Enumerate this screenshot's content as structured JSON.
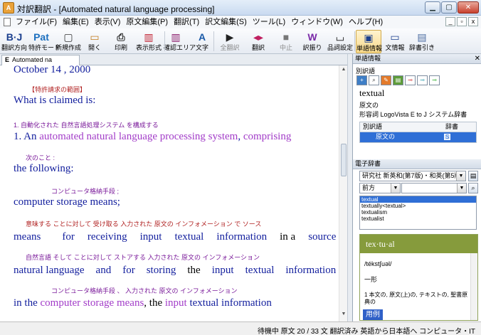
{
  "window": {
    "title": "対訳翻訳 - [Automated natural language processing]",
    "app_icon_text": "A"
  },
  "menu": {
    "items": [
      "ファイル(F)",
      "編集(E)",
      "表示(V)",
      "原文編集(P)",
      "翻訳(T)",
      "訳文編集(S)",
      "ツール(L)",
      "ウィンドウ(W)",
      "ヘルプ(H)"
    ]
  },
  "toolbar": {
    "buttons": [
      {
        "label": "翻訳方向",
        "icon": "direction-icon",
        "glyph": "B·J"
      },
      {
        "label": "特許モード",
        "icon": "patent-icon",
        "glyph": "Pat"
      },
      {
        "label": "新規作成",
        "icon": "new-doc-icon",
        "glyph": "▢"
      },
      {
        "label": "開く",
        "icon": "open-folder-icon",
        "glyph": "▭"
      },
      {
        "label": "印刷",
        "icon": "printer-icon",
        "glyph": "⎙"
      },
      {
        "label": "表示形式",
        "icon": "layout-icon",
        "glyph": "▥"
      },
      {
        "label": "確認エリア",
        "icon": "confirm-area-icon",
        "glyph": "▥"
      },
      {
        "label": "文字",
        "icon": "font-icon",
        "glyph": "A"
      },
      {
        "label": "全翻訳",
        "icon": "play-icon",
        "glyph": "▶"
      },
      {
        "label": "翻訳",
        "icon": "translate-icon",
        "glyph": "◂▸"
      },
      {
        "label": "中止",
        "icon": "stop-icon",
        "glyph": "■"
      },
      {
        "label": "訳振り",
        "icon": "annotate-icon",
        "glyph": "W"
      },
      {
        "label": "品詞設定",
        "icon": "pos-icon",
        "glyph": "⌴"
      },
      {
        "label": "単語情報",
        "icon": "word-info-icon",
        "glyph": "▣"
      },
      {
        "label": "文情報",
        "icon": "sentence-info-icon",
        "glyph": "▭"
      },
      {
        "label": "辞書引き",
        "icon": "dictionary-icon",
        "glyph": "▤"
      }
    ]
  },
  "tabs": {
    "active": {
      "prefix": "E",
      "label": "Automated na"
    }
  },
  "document": {
    "lines": [
      {
        "type": "en",
        "text": "October 14 , 2000"
      },
      {
        "type": "jp",
        "text": "【特許請求の範囲】"
      },
      {
        "type": "en",
        "text": "What is claimed is:"
      },
      {
        "type": "jp",
        "text": "1.          自動化された                     自然言語処理システム                       を構成する"
      },
      {
        "type": "en",
        "parts": [
          "1. An ",
          "automated natural language processing system",
          ", ",
          "comprising"
        ]
      },
      {
        "type": "jp",
        "text": "次のこと        :"
      },
      {
        "type": "en",
        "text": "the following:"
      },
      {
        "type": "jp",
        "text": "コンピュータ格納手段            ;"
      },
      {
        "type": "en",
        "text": "computer storage means;"
      },
      {
        "type": "jp",
        "text": "意味する ことに対して   受け取る   入力された   原文の   インフォメーション  で    ソース"
      },
      {
        "type": "en",
        "parts": [
          "means",
          "for",
          "receiving",
          "input",
          "textual",
          "information",
          "in a",
          "source"
        ]
      },
      {
        "type": "jp",
        "text": "自然言語            そして ことに対して ストアする          入力された   原文の   インフォメーション"
      },
      {
        "type": "en",
        "parts": [
          "natural language",
          "and",
          "for",
          "storing",
          "the",
          "input",
          "textual",
          "information"
        ]
      },
      {
        "type": "jp",
        "text": "コンピュータ格納手段              、          入力された   原文の   インフォメーション"
      },
      {
        "type": "en",
        "parts": [
          "in the ",
          "computer storage means",
          ", the ",
          "input",
          " textual",
          " information"
        ]
      }
    ]
  },
  "word_info": {
    "title": "単語情報",
    "alt_label": "別訳語",
    "headword": "textual",
    "gloss": "原文の",
    "pos_source": "形容詞  LogoVista E to J システム辞書",
    "table_header": {
      "c1": "別訳語",
      "c2": "辞書"
    },
    "table_rows": [
      {
        "c1": "原文の",
        "c2": "S"
      }
    ]
  },
  "e_dict": {
    "title": "電子辞書",
    "dictionary": "研究社 新英和(第7版)・和英(第5版",
    "match_mode": "前方",
    "search_value": "",
    "entries": [
      "textual",
      "textually<textual>",
      "textualism",
      "textualist"
    ],
    "selected_index": 0,
    "entry_head": "tex·tu·al",
    "pron": "/tékst∫uəl/",
    "pos_mark": "一形",
    "definition": "1 本文の, 原文(上)の, テキストの, 聖書原典の",
    "example_btn": "用例"
  },
  "status": {
    "text": "待機中  原文  20 / 33 文  翻訳済み  英語から日本語へ  コンピュータ・IT"
  },
  "colors": {
    "title_bg": "#c9daf0",
    "jp_text": "#7a1a9a",
    "en_text": "#14209e",
    "dict_header": "#869b3c",
    "selection": "#2f6fd6"
  }
}
